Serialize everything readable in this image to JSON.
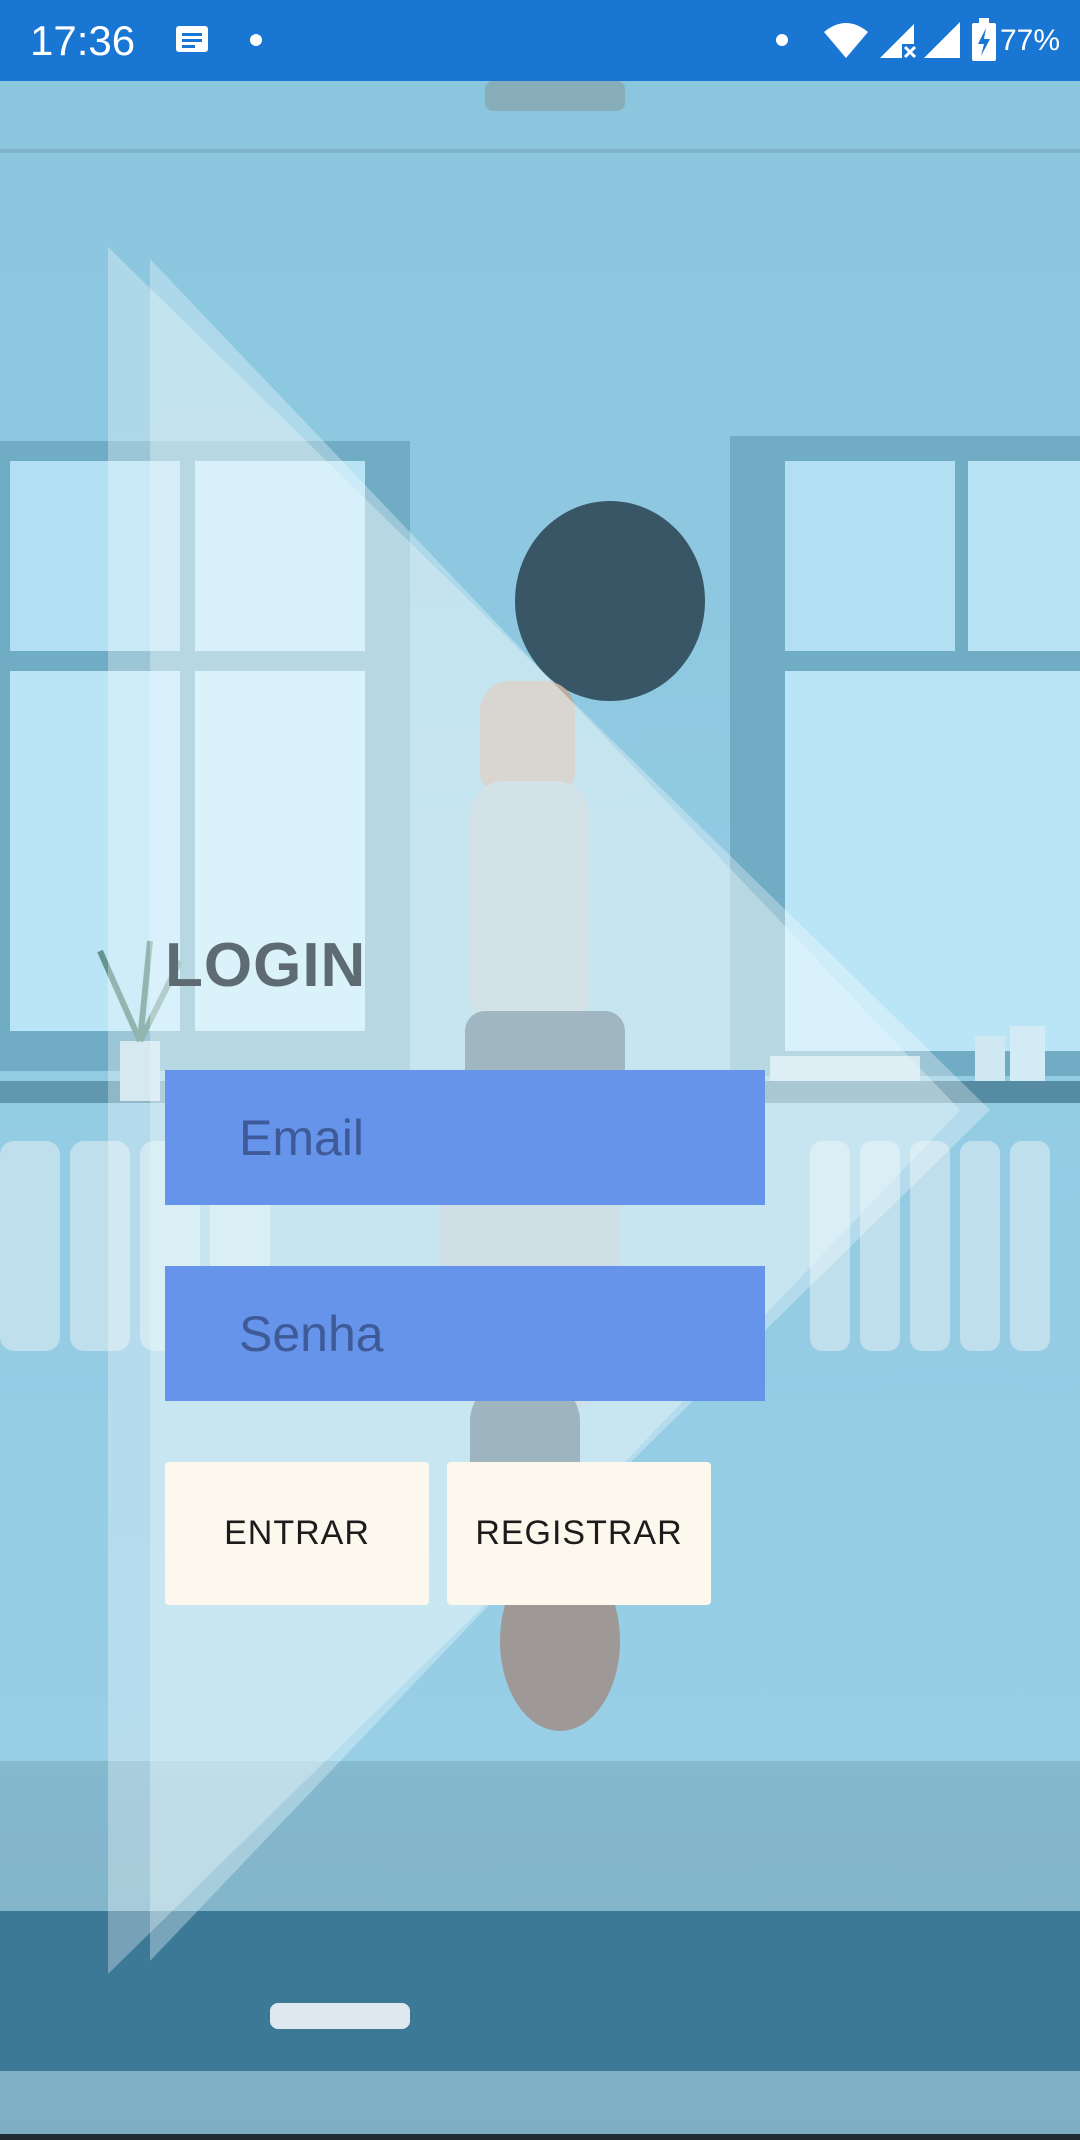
{
  "status_bar": {
    "time": "17:36",
    "battery": "77%",
    "background_color": "#1976d2",
    "icons": [
      "message-icon",
      "wifi-icon",
      "signal-no-service-icon",
      "signal-icon",
      "battery-charging-icon"
    ]
  },
  "login": {
    "title": "LOGIN",
    "email_placeholder": "Email",
    "password_placeholder": "Senha",
    "enter_label": "ENTRAR",
    "register_label": "REGISTRAR"
  },
  "colors": {
    "input_background": "#6694ea",
    "button_background": "#fdf8ed",
    "title_color": "#5f6b72"
  }
}
